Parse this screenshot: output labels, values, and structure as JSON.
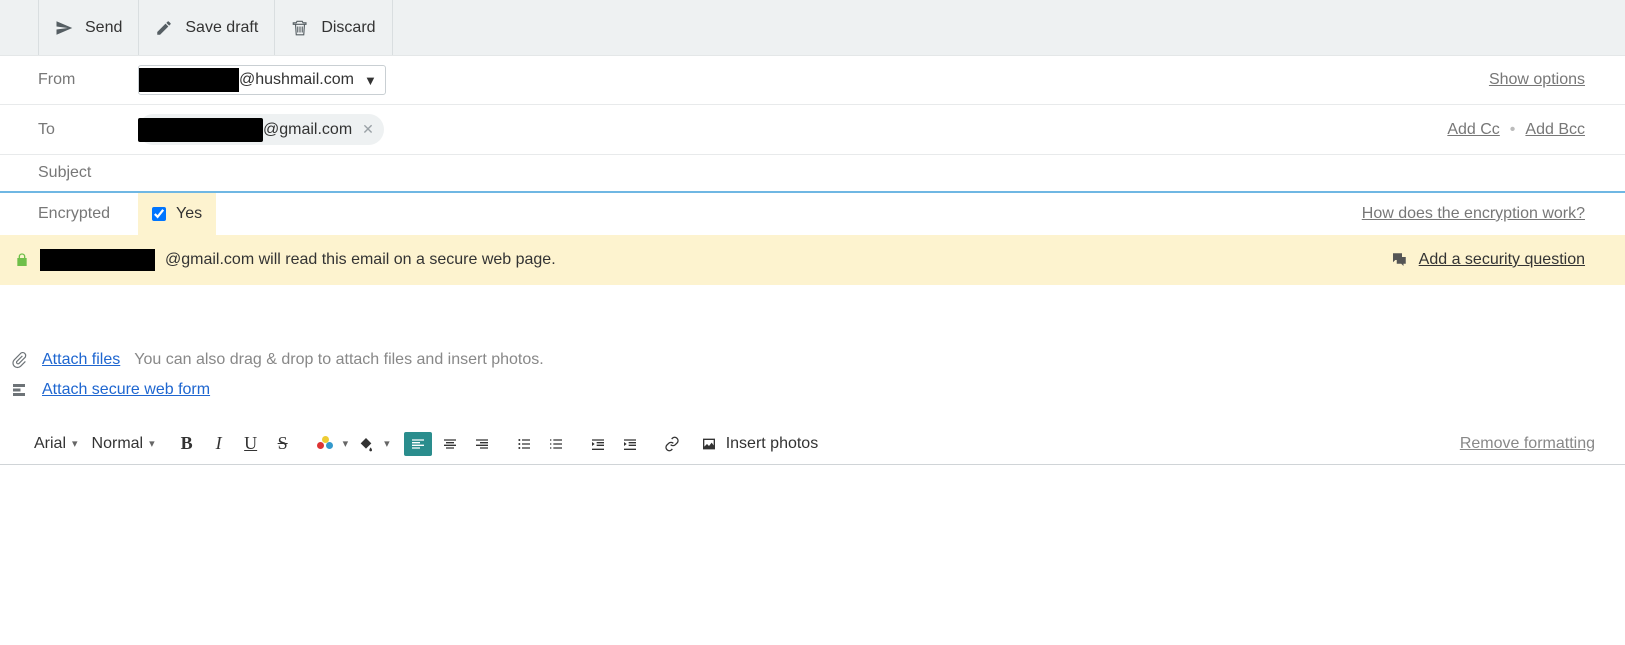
{
  "toolbar": {
    "send": "Send",
    "save_draft": "Save draft",
    "discard": "Discard"
  },
  "fields": {
    "from_label": "From",
    "from_domain": "@hushmail.com",
    "to_label": "To",
    "to_domain": "@gmail.com",
    "subject_label": "Subject",
    "subject_value": "",
    "encrypted_label": "Encrypted",
    "encrypted_yes": "Yes",
    "encrypted_checked": true
  },
  "right_links": {
    "show_options": "Show options",
    "add_cc": "Add Cc",
    "add_bcc": "Add Bcc",
    "how_encryption": "How does the encryption work?"
  },
  "notice": {
    "recipient_domain": "@gmail.com",
    "text_tail": " will read this email on a secure web page.",
    "add_security_q": "Add a security question"
  },
  "attach": {
    "attach_files": "Attach files",
    "attach_hint": "You can also drag & drop to attach files and insert photos.",
    "attach_form": "Attach secure web form"
  },
  "editor": {
    "font": "Arial",
    "size": "Normal",
    "insert_photos": "Insert photos",
    "remove_formatting": "Remove formatting"
  }
}
